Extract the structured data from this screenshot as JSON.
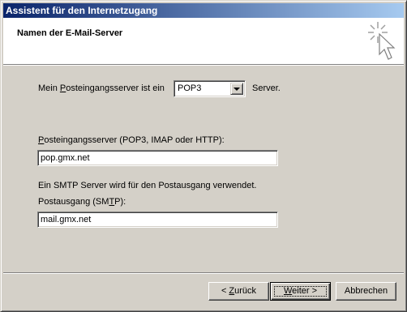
{
  "window": {
    "title": "Assistent für den Internetzugang",
    "header_title": "Namen der E-Mail-Server"
  },
  "server_type": {
    "prefix_pre": "Mein ",
    "prefix_mnemonic": "P",
    "prefix_post": "osteingangsserver ist ein",
    "selected": "POP3",
    "suffix": "Server."
  },
  "incoming": {
    "label_mnemonic": "P",
    "label_rest": "osteingangsserver (POP3, IMAP oder HTTP):",
    "value": "pop.gmx.net"
  },
  "smtp_note": "Ein SMTP Server wird für den Postausgang verwendet.",
  "outgoing": {
    "label_pre": "Postausgang (SM",
    "label_mnemonic": "T",
    "label_post": "P):",
    "value": "mail.gmx.net"
  },
  "buttons": {
    "back_pre": "< ",
    "back_mnemonic": "Z",
    "back_post": "urück",
    "next_mnemonic": "W",
    "next_post": "eiter >",
    "cancel": "Abbrechen"
  },
  "colors": {
    "dialog_face": "#d4d0c8",
    "title_start": "#0a246a",
    "title_end": "#a6caf0"
  },
  "icons": {
    "wizard": "wizard-sparkle-cursor-icon",
    "dropdown": "chevron-down-icon"
  }
}
